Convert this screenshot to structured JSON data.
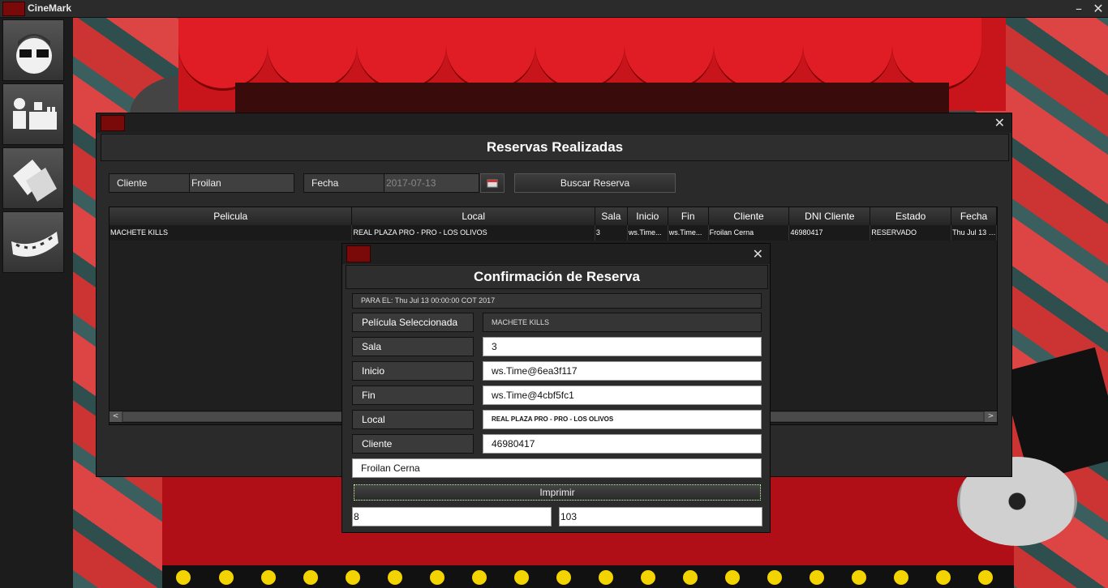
{
  "app": {
    "title": "CineMark",
    "minimize": "–",
    "close": "✕"
  },
  "sidebar": {
    "items": [
      {
        "icon": "user-glasses-icon"
      },
      {
        "icon": "cashier-icon"
      },
      {
        "icon": "tickets-icon"
      },
      {
        "icon": "film-strip-icon"
      }
    ]
  },
  "main_window": {
    "close": "✕",
    "heading": "Reservas Realizadas",
    "filters": {
      "cliente_label": "Cliente",
      "cliente_value": "Froilan",
      "fecha_label": "Fecha",
      "fecha_value": "2017-07-13",
      "calendar_icon": "calendar-icon",
      "search_button": "Buscar Reserva"
    },
    "table": {
      "columns": [
        "Pelicula",
        "Local",
        "Sala",
        "Inicio",
        "Fin",
        "Cliente",
        "DNI Cliente",
        "Estado",
        "Fecha"
      ],
      "rows": [
        [
          "MACHETE KILLS",
          "REAL PLAZA PRO - PRO - LOS OLIVOS",
          "3",
          "ws.Time...",
          "ws.Time...",
          "Froilan Cerna",
          "46980417",
          "RESERVADO",
          "Thu Jul 13 0..."
        ]
      ]
    },
    "scroll_left": "<",
    "scroll_right": ">"
  },
  "dialog": {
    "close": "✕",
    "heading": "Confirmación de Reserva",
    "date_line": "PARA EL: Thu Jul 13 00:00:00 COT 2017",
    "fields": {
      "pelicula_label": "Película Seleccionada",
      "pelicula_value": "MACHETE KILLS",
      "sala_label": "Sala",
      "sala_value": "3",
      "inicio_label": "Inicio",
      "inicio_value": "ws.Time@6ea3f117",
      "fin_label": "Fin",
      "fin_value": "ws.Time@4cbf5fc1",
      "local_label": "Local",
      "local_value": "REAL PLAZA PRO - PRO - LOS OLIVOS",
      "cliente_label": "Cliente",
      "cliente_value": "46980417",
      "nombre_value": "Froilan Cerna"
    },
    "print_button": "Imprimir",
    "extra_left": "8",
    "extra_right": "103"
  },
  "colors": {
    "accent_red": "#c8141b",
    "panel": "#2b2b2b",
    "bulb": "#f4d400"
  }
}
